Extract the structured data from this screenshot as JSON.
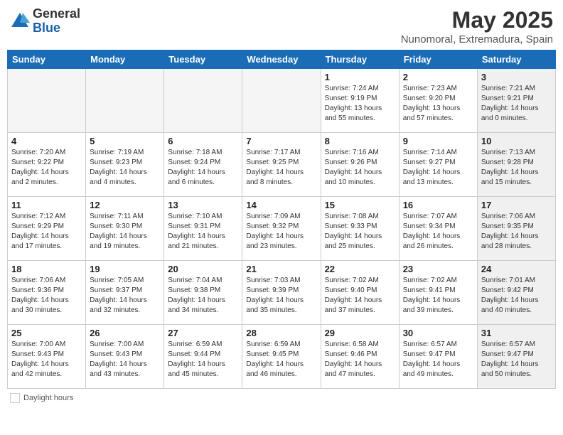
{
  "header": {
    "logo_general": "General",
    "logo_blue": "Blue",
    "month": "May 2025",
    "location": "Nunomoral, Extremadura, Spain"
  },
  "footer": {
    "daylight_label": "Daylight hours"
  },
  "days_of_week": [
    "Sunday",
    "Monday",
    "Tuesday",
    "Wednesday",
    "Thursday",
    "Friday",
    "Saturday"
  ],
  "weeks": [
    [
      {
        "num": "",
        "info": "",
        "empty": true
      },
      {
        "num": "",
        "info": "",
        "empty": true
      },
      {
        "num": "",
        "info": "",
        "empty": true
      },
      {
        "num": "",
        "info": "",
        "empty": true
      },
      {
        "num": "1",
        "info": "Sunrise: 7:24 AM\nSunset: 9:19 PM\nDaylight: 13 hours\nand 55 minutes.",
        "gray": false
      },
      {
        "num": "2",
        "info": "Sunrise: 7:23 AM\nSunset: 9:20 PM\nDaylight: 13 hours\nand 57 minutes.",
        "gray": false
      },
      {
        "num": "3",
        "info": "Sunrise: 7:21 AM\nSunset: 9:21 PM\nDaylight: 14 hours\nand 0 minutes.",
        "gray": true
      }
    ],
    [
      {
        "num": "4",
        "info": "Sunrise: 7:20 AM\nSunset: 9:22 PM\nDaylight: 14 hours\nand 2 minutes.",
        "gray": false
      },
      {
        "num": "5",
        "info": "Sunrise: 7:19 AM\nSunset: 9:23 PM\nDaylight: 14 hours\nand 4 minutes.",
        "gray": false
      },
      {
        "num": "6",
        "info": "Sunrise: 7:18 AM\nSunset: 9:24 PM\nDaylight: 14 hours\nand 6 minutes.",
        "gray": false
      },
      {
        "num": "7",
        "info": "Sunrise: 7:17 AM\nSunset: 9:25 PM\nDaylight: 14 hours\nand 8 minutes.",
        "gray": false
      },
      {
        "num": "8",
        "info": "Sunrise: 7:16 AM\nSunset: 9:26 PM\nDaylight: 14 hours\nand 10 minutes.",
        "gray": false
      },
      {
        "num": "9",
        "info": "Sunrise: 7:14 AM\nSunset: 9:27 PM\nDaylight: 14 hours\nand 13 minutes.",
        "gray": false
      },
      {
        "num": "10",
        "info": "Sunrise: 7:13 AM\nSunset: 9:28 PM\nDaylight: 14 hours\nand 15 minutes.",
        "gray": true
      }
    ],
    [
      {
        "num": "11",
        "info": "Sunrise: 7:12 AM\nSunset: 9:29 PM\nDaylight: 14 hours\nand 17 minutes.",
        "gray": false
      },
      {
        "num": "12",
        "info": "Sunrise: 7:11 AM\nSunset: 9:30 PM\nDaylight: 14 hours\nand 19 minutes.",
        "gray": false
      },
      {
        "num": "13",
        "info": "Sunrise: 7:10 AM\nSunset: 9:31 PM\nDaylight: 14 hours\nand 21 minutes.",
        "gray": false
      },
      {
        "num": "14",
        "info": "Sunrise: 7:09 AM\nSunset: 9:32 PM\nDaylight: 14 hours\nand 23 minutes.",
        "gray": false
      },
      {
        "num": "15",
        "info": "Sunrise: 7:08 AM\nSunset: 9:33 PM\nDaylight: 14 hours\nand 25 minutes.",
        "gray": false
      },
      {
        "num": "16",
        "info": "Sunrise: 7:07 AM\nSunset: 9:34 PM\nDaylight: 14 hours\nand 26 minutes.",
        "gray": false
      },
      {
        "num": "17",
        "info": "Sunrise: 7:06 AM\nSunset: 9:35 PM\nDaylight: 14 hours\nand 28 minutes.",
        "gray": true
      }
    ],
    [
      {
        "num": "18",
        "info": "Sunrise: 7:06 AM\nSunset: 9:36 PM\nDaylight: 14 hours\nand 30 minutes.",
        "gray": false
      },
      {
        "num": "19",
        "info": "Sunrise: 7:05 AM\nSunset: 9:37 PM\nDaylight: 14 hours\nand 32 minutes.",
        "gray": false
      },
      {
        "num": "20",
        "info": "Sunrise: 7:04 AM\nSunset: 9:38 PM\nDaylight: 14 hours\nand 34 minutes.",
        "gray": false
      },
      {
        "num": "21",
        "info": "Sunrise: 7:03 AM\nSunset: 9:39 PM\nDaylight: 14 hours\nand 35 minutes.",
        "gray": false
      },
      {
        "num": "22",
        "info": "Sunrise: 7:02 AM\nSunset: 9:40 PM\nDaylight: 14 hours\nand 37 minutes.",
        "gray": false
      },
      {
        "num": "23",
        "info": "Sunrise: 7:02 AM\nSunset: 9:41 PM\nDaylight: 14 hours\nand 39 minutes.",
        "gray": false
      },
      {
        "num": "24",
        "info": "Sunrise: 7:01 AM\nSunset: 9:42 PM\nDaylight: 14 hours\nand 40 minutes.",
        "gray": true
      }
    ],
    [
      {
        "num": "25",
        "info": "Sunrise: 7:00 AM\nSunset: 9:43 PM\nDaylight: 14 hours\nand 42 minutes.",
        "gray": false
      },
      {
        "num": "26",
        "info": "Sunrise: 7:00 AM\nSunset: 9:43 PM\nDaylight: 14 hours\nand 43 minutes.",
        "gray": false
      },
      {
        "num": "27",
        "info": "Sunrise: 6:59 AM\nSunset: 9:44 PM\nDaylight: 14 hours\nand 45 minutes.",
        "gray": false
      },
      {
        "num": "28",
        "info": "Sunrise: 6:59 AM\nSunset: 9:45 PM\nDaylight: 14 hours\nand 46 minutes.",
        "gray": false
      },
      {
        "num": "29",
        "info": "Sunrise: 6:58 AM\nSunset: 9:46 PM\nDaylight: 14 hours\nand 47 minutes.",
        "gray": false
      },
      {
        "num": "30",
        "info": "Sunrise: 6:57 AM\nSunset: 9:47 PM\nDaylight: 14 hours\nand 49 minutes.",
        "gray": false
      },
      {
        "num": "31",
        "info": "Sunrise: 6:57 AM\nSunset: 9:47 PM\nDaylight: 14 hours\nand 50 minutes.",
        "gray": true
      }
    ]
  ]
}
